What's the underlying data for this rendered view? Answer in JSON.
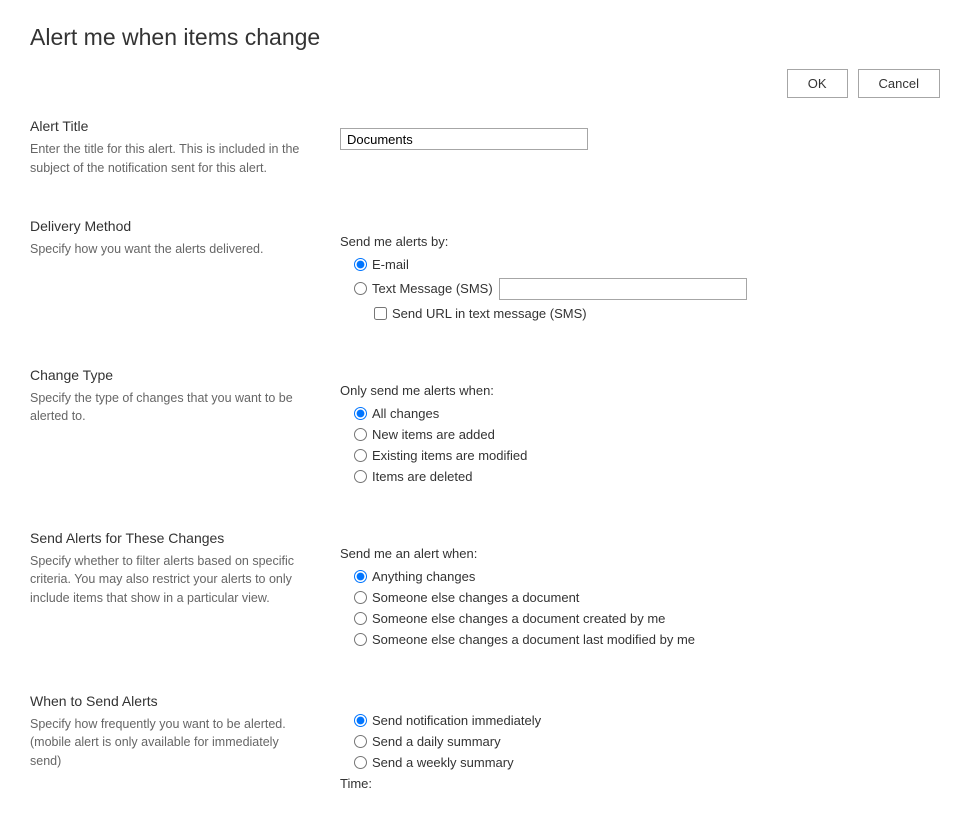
{
  "page_title": "Alert me when items change",
  "buttons": {
    "ok": "OK",
    "cancel": "Cancel"
  },
  "sections": {
    "alert_title": {
      "heading": "Alert Title",
      "desc": "Enter the title for this alert. This is included in the subject of the notification sent for this alert.",
      "value": "Documents"
    },
    "delivery": {
      "heading": "Delivery Method",
      "desc": "Specify how you want the alerts delivered.",
      "label": "Send me alerts by:",
      "options": {
        "email": "E-mail",
        "sms": "Text Message (SMS)"
      },
      "send_url": "Send URL in text message (SMS)"
    },
    "change_type": {
      "heading": "Change Type",
      "desc": "Specify the type of changes that you want to be alerted to.",
      "label": "Only send me alerts when:",
      "options": {
        "all": "All changes",
        "new": "New items are added",
        "modified": "Existing items are modified",
        "deleted": "Items are deleted"
      }
    },
    "filter": {
      "heading": "Send Alerts for These Changes",
      "desc": "Specify whether to filter alerts based on specific criteria. You may also restrict your alerts to only include items that show in a particular view.",
      "label": "Send me an alert when:",
      "options": {
        "anything": "Anything changes",
        "else_changes": "Someone else changes a document",
        "else_created_me": "Someone else changes a document created by me",
        "else_modified_me": "Someone else changes a document last modified by me"
      }
    },
    "when": {
      "heading": "When to Send Alerts",
      "desc": "Specify how frequently you want to be alerted. (mobile alert is only available for immediately send)",
      "options": {
        "immediate": "Send notification immediately",
        "daily": "Send a daily summary",
        "weekly": "Send a weekly summary"
      },
      "time_label": "Time:"
    }
  }
}
